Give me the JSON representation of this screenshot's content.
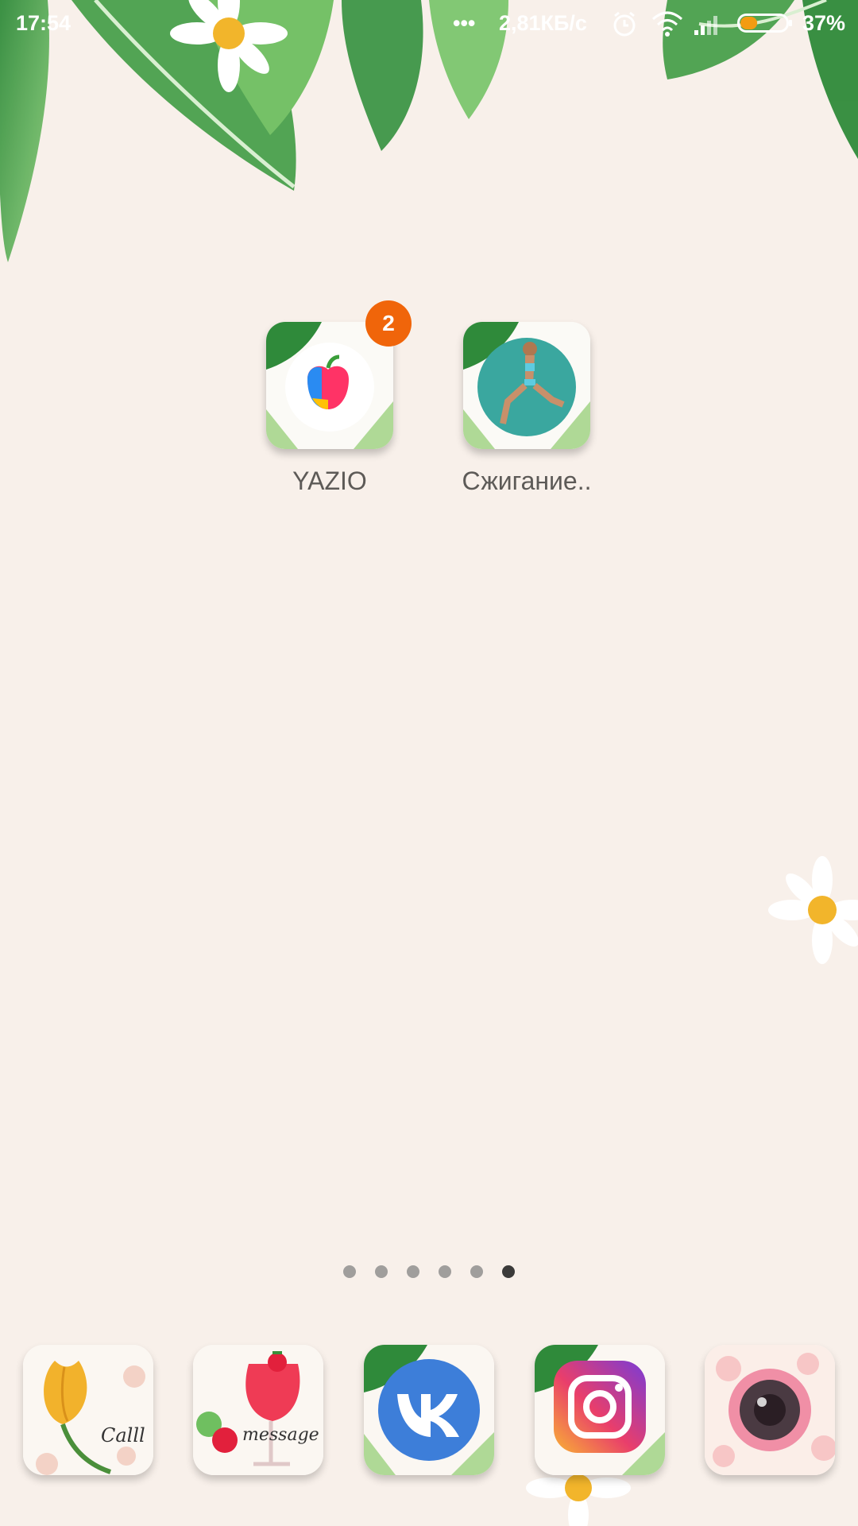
{
  "status_bar": {
    "time": "17:54",
    "dots": "•••",
    "network_speed": "2,81КБ/с",
    "battery_percent": "37%",
    "battery_level": 0.37,
    "icons": [
      "alarm-icon",
      "wifi-icon",
      "signal-icon",
      "battery-icon"
    ]
  },
  "home": {
    "apps": [
      {
        "label": "YAZIO",
        "badge": "2",
        "icon": "yazio-apple-icon"
      },
      {
        "label": "Сжигание..",
        "icon": "fitness-woman-icon"
      }
    ]
  },
  "page_indicator": {
    "count": 6,
    "active_index": 5
  },
  "dock": {
    "apps": [
      {
        "name": "phone",
        "caption": "Calll",
        "icon": "tulip-phone-icon"
      },
      {
        "name": "messages",
        "caption": "message",
        "icon": "strawberry-drink-icon"
      },
      {
        "name": "vk",
        "icon": "vk-icon"
      },
      {
        "name": "instagram",
        "icon": "instagram-icon"
      },
      {
        "name": "camera",
        "icon": "camera-icon"
      }
    ]
  },
  "colors": {
    "background": "#f8f0ea",
    "badge": "#f0650a",
    "label": "#5d5a57",
    "vk_blue": "#3d7ed9"
  }
}
